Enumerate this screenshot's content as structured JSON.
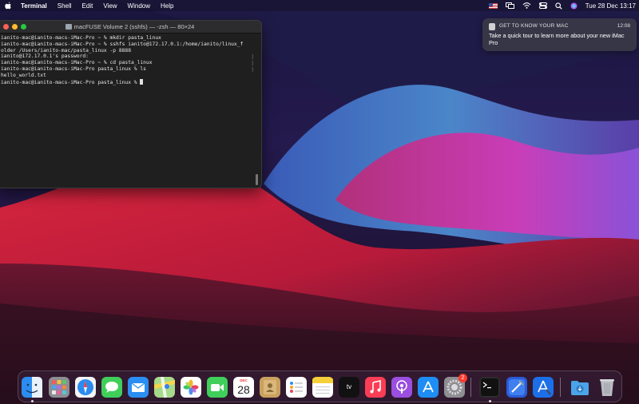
{
  "menubar": {
    "items": [
      "Terminal",
      "Shell",
      "Edit",
      "View",
      "Window",
      "Help"
    ],
    "clock": "Tue 28 Dec  13:17"
  },
  "terminal": {
    "title": "macFUSE Volume 2 (sshfs) — -zsh — 80×24",
    "lines": [
      "ianito-mac@ianito-macs-iMac-Pro ~ % mkdir pasta_linux",
      "ianito-mac@ianito-macs-iMac-Pro ~ % sshfs ianito@172.17.0.1:/home/ianito/linux_f",
      "older /Users/ianito-mac/pasta_linux -p 8888",
      "ianito@172.17.0.1's password:",
      "ianito-mac@ianito-macs-iMac-Pro ~ % cd pasta_linux",
      "ianito-mac@ianito-macs-iMac-Pro pasta_linux % ls",
      "hello_world.txt",
      "ianito-mac@ianito-macs-iMac-Pro pasta_linux % "
    ]
  },
  "notification": {
    "app": "GET TO KNOW YOUR MAC",
    "time": "12:08",
    "body": "Take a quick tour to learn more about your new iMac Pro"
  },
  "dock": {
    "calendar_month": "DEC",
    "calendar_day": "28",
    "tv_label": "tv",
    "settings_badge": "2",
    "icons": [
      "finder-icon",
      "launchpad-icon",
      "safari-icon",
      "messages-icon",
      "mail-icon",
      "maps-icon",
      "photos-icon",
      "facetime-icon",
      "calendar-icon",
      "contacts-icon",
      "reminders-icon",
      "notes-icon",
      "appletv-icon",
      "music-icon",
      "podcasts-icon",
      "appstore-icon",
      "system-preferences-icon",
      "terminal-icon",
      "xcode-icon",
      "xcode-instruments-icon",
      "downloads-folder-icon",
      "trash-icon"
    ]
  }
}
